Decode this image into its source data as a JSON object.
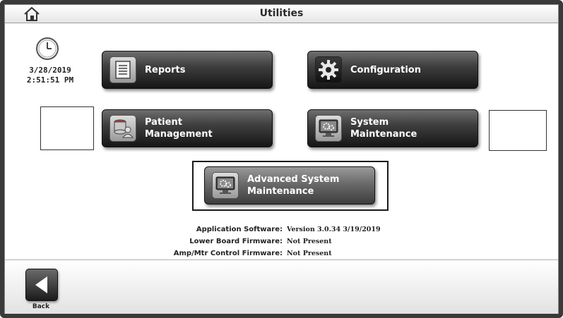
{
  "window": {
    "title": "Utilities"
  },
  "header": {
    "home_icon": "home-icon"
  },
  "clock": {
    "icon": "clock-icon",
    "date": "3/28/2019",
    "time": "2:51:51 PM"
  },
  "buttons": {
    "reports": {
      "label": "Reports",
      "icon": "report-icon"
    },
    "configuration": {
      "label": "Configuration",
      "icon": "gear-icon"
    },
    "patient_management": {
      "line1": "Patient",
      "line2": "Management",
      "icon": "database-user-icon"
    },
    "system_maintenance": {
      "line1": "System",
      "line2": "Maintenance",
      "icon": "monitor-gears-icon"
    },
    "advanced_system_maintenance": {
      "line1": "Advanced System",
      "line2": "Maintenance",
      "icon": "monitor-gears-icon"
    }
  },
  "info": {
    "application_software": {
      "label": "Application Software:",
      "value": "Version 3.0.34  3/19/2019"
    },
    "lower_board_firmware": {
      "label": "Lower Board Firmware:",
      "value": "Not Present"
    },
    "amp_mtr_firmware": {
      "label": "Amp/Mtr Control Firmware:",
      "value": "Not Present"
    }
  },
  "footer": {
    "back_label": "Back",
    "back_icon": "back-arrow-icon"
  },
  "colors": {
    "button_top": "#6e6e6e",
    "button_bottom": "#161616",
    "frame": "#3a3a3a"
  }
}
